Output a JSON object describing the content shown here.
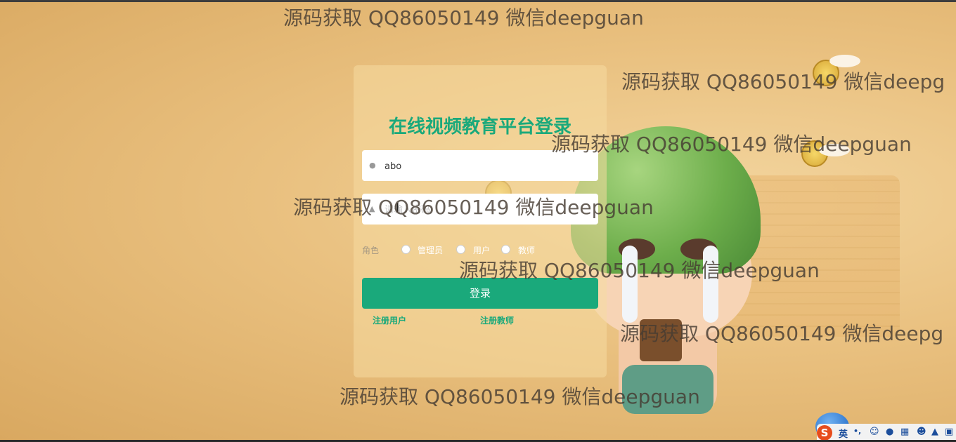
{
  "login": {
    "title": "在线视频教育平台登录",
    "username_value": "abo",
    "password_placeholder": "请输入密码",
    "role_label": "角色",
    "roles": [
      "管理员",
      "用户",
      "教师"
    ],
    "login_button": "登录",
    "register_user": "注册用户",
    "register_teacher": "注册教师"
  },
  "watermarks": [
    "源码获取 QQ86050149 微信deepguan",
    "源码获取 QQ86050149 微信deepg",
    "源码获取 QQ86050149 微信deepguan",
    "源码获取 QQ86050149 微信deepguan",
    "源码获取 QQ86050149 微信deepguan",
    "源码获取 QQ86050149 微信deepg",
    "源码获取 QQ86050149 微信deepguan"
  ],
  "ime": {
    "logo": "S",
    "lang": "英",
    "punct": "•,",
    "icons": [
      "emoji-icon",
      "mic-icon",
      "keyboard-icon",
      "user-icon",
      "shirt-icon",
      "grid-icon"
    ]
  },
  "colors": {
    "accent": "#1aa97b"
  }
}
